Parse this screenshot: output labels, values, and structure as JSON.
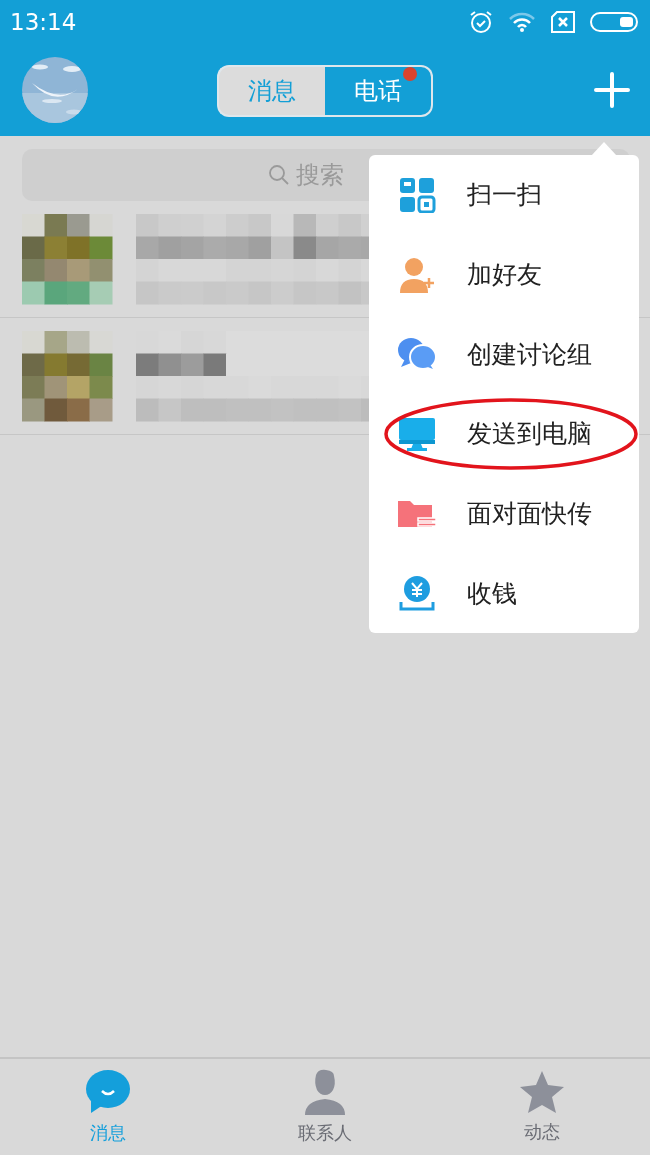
{
  "status_bar": {
    "time": "13:14"
  },
  "header": {
    "tabs": [
      {
        "label": "消息",
        "selected": true,
        "badge": false
      },
      {
        "label": "电话",
        "selected": false,
        "badge": true
      }
    ]
  },
  "search": {
    "placeholder": "搜索"
  },
  "menu": {
    "items": [
      {
        "label": "扫一扫",
        "kind": "scan",
        "highlighted": false
      },
      {
        "label": "加好友",
        "kind": "add-friend",
        "highlighted": false
      },
      {
        "label": "创建讨论组",
        "kind": "group-chat",
        "highlighted": false
      },
      {
        "label": "发送到电脑",
        "kind": "computer",
        "highlighted": true
      },
      {
        "label": "面对面快传",
        "kind": "file-transfer",
        "highlighted": false
      },
      {
        "label": "收钱",
        "kind": "money",
        "highlighted": false
      }
    ]
  },
  "bottom_nav": [
    {
      "label": "消息",
      "kind": "chat",
      "selected": true
    },
    {
      "label": "联系人",
      "kind": "contact",
      "selected": false
    },
    {
      "label": "动态",
      "kind": "star",
      "selected": false
    }
  ]
}
